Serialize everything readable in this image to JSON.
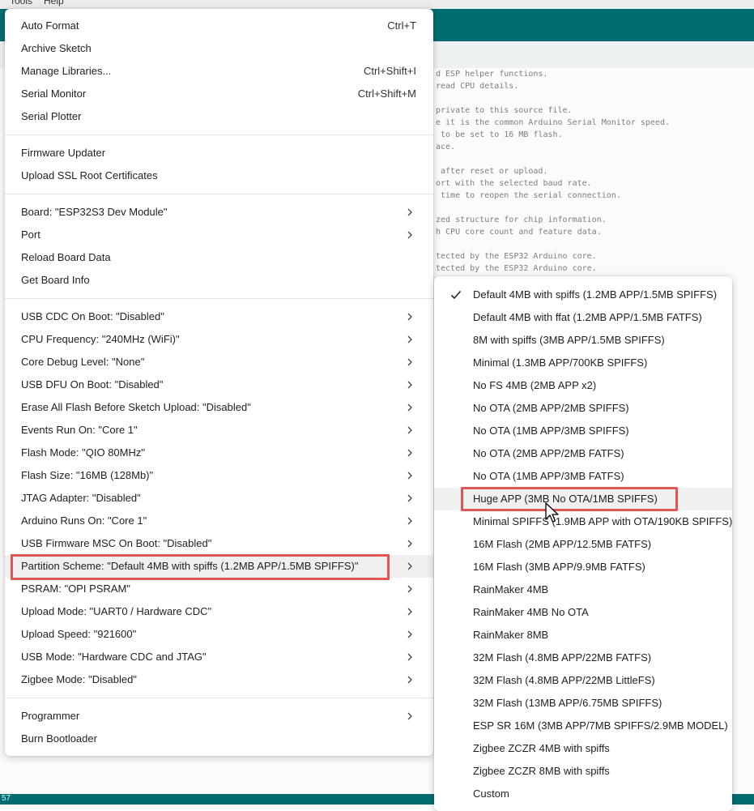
{
  "menubar": {
    "tools": "Tools",
    "help": "Help"
  },
  "code_lines": [
    "d ESP helper functions.",
    "read CPU details.",
    "",
    "private to this source file.",
    "e it is the common Arduino Serial Monitor speed.",
    " to be set to 16 MB flash.",
    "ace.",
    "",
    " after reset or upload.",
    "ort with the selected baud rate.",
    " time to reopen the serial connection.",
    "",
    "zed structure for chip information.",
    "h CPU core count and feature data.",
    "",
    "tected by the ESP32 Arduino core.",
    "tected by the ESP32 Arduino core."
  ],
  "status": {
    "text": "57"
  },
  "tools_menu": {
    "items": [
      {
        "label": "Auto Format",
        "shortcut": "Ctrl+T"
      },
      {
        "label": "Archive Sketch"
      },
      {
        "label": "Manage Libraries...",
        "shortcut": "Ctrl+Shift+I"
      },
      {
        "label": "Serial Monitor",
        "shortcut": "Ctrl+Shift+M"
      },
      {
        "label": "Serial Plotter"
      },
      {
        "label": "Firmware Updater"
      },
      {
        "label": "Upload SSL Root Certificates"
      },
      {
        "label": "Board: \"ESP32S3 Dev Module\""
      },
      {
        "label": "Port"
      },
      {
        "label": "Reload Board Data"
      },
      {
        "label": "Get Board Info"
      },
      {
        "label": "USB CDC On Boot: \"Disabled\""
      },
      {
        "label": "CPU Frequency: \"240MHz (WiFi)\""
      },
      {
        "label": "Core Debug Level: \"None\""
      },
      {
        "label": "USB DFU On Boot: \"Disabled\""
      },
      {
        "label": "Erase All Flash Before Sketch Upload: \"Disabled\""
      },
      {
        "label": "Events Run On: \"Core 1\""
      },
      {
        "label": "Flash Mode: \"QIO 80MHz\""
      },
      {
        "label": "Flash Size: \"16MB (128Mb)\""
      },
      {
        "label": "JTAG Adapter: \"Disabled\""
      },
      {
        "label": "Arduino Runs On: \"Core 1\""
      },
      {
        "label": "USB Firmware MSC On Boot: \"Disabled\""
      },
      {
        "label": "Partition Scheme: \"Default 4MB with spiffs (1.2MB APP/1.5MB SPIFFS)\""
      },
      {
        "label": "PSRAM: \"OPI PSRAM\""
      },
      {
        "label": "Upload Mode: \"UART0 / Hardware CDC\""
      },
      {
        "label": "Upload Speed: \"921600\""
      },
      {
        "label": "USB Mode: \"Hardware CDC and JTAG\""
      },
      {
        "label": "Zigbee Mode: \"Disabled\""
      },
      {
        "label": "Programmer"
      },
      {
        "label": "Burn Bootloader"
      }
    ]
  },
  "partition_submenu": {
    "items": [
      {
        "label": "Default 4MB with spiffs (1.2MB APP/1.5MB SPIFFS)",
        "checked": true
      },
      {
        "label": "Default 4MB with ffat (1.2MB APP/1.5MB FATFS)"
      },
      {
        "label": "8M with spiffs (3MB APP/1.5MB SPIFFS)"
      },
      {
        "label": "Minimal (1.3MB APP/700KB SPIFFS)"
      },
      {
        "label": "No FS 4MB (2MB APP x2)"
      },
      {
        "label": "No OTA (2MB APP/2MB SPIFFS)"
      },
      {
        "label": "No OTA (1MB APP/3MB SPIFFS)"
      },
      {
        "label": "No OTA (2MB APP/2MB FATFS)"
      },
      {
        "label": "No OTA (1MB APP/3MB FATFS)"
      },
      {
        "label": "Huge APP (3MB No OTA/1MB SPIFFS)",
        "highlighted": true
      },
      {
        "label": "Minimal SPIFFS (1.9MB APP with OTA/190KB SPIFFS)"
      },
      {
        "label": "16M Flash (2MB APP/12.5MB FATFS)"
      },
      {
        "label": "16M Flash (3MB APP/9.9MB FATFS)"
      },
      {
        "label": "RainMaker 4MB"
      },
      {
        "label": "RainMaker 4MB No OTA"
      },
      {
        "label": "RainMaker 8MB"
      },
      {
        "label": "32M Flash (4.8MB APP/22MB FATFS)"
      },
      {
        "label": "32M Flash (4.8MB APP/22MB LittleFS)"
      },
      {
        "label": "32M Flash (13MB APP/6.75MB SPIFFS)"
      },
      {
        "label": "ESP SR 16M (3MB APP/7MB SPIFFS/2.9MB MODEL)"
      },
      {
        "label": "Zigbee ZCZR 4MB with spiffs"
      },
      {
        "label": "Zigbee ZCZR 8MB with spiffs"
      },
      {
        "label": "Custom"
      }
    ]
  },
  "colors": {
    "teal": "#006d72",
    "highlight_box": "#e05555",
    "hover_bg": "#f0f0f0"
  }
}
